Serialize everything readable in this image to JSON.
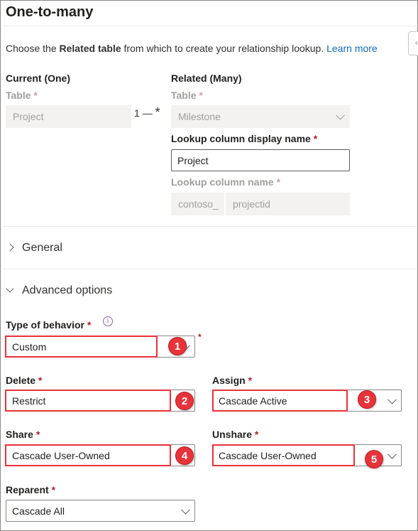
{
  "panel": {
    "title": "One-to-many",
    "intro_prefix": "Choose the ",
    "intro_bold": "Related table",
    "intro_suffix": " from which to create your relationship lookup. ",
    "learn_more": "Learn more"
  },
  "current": {
    "heading": "Current (One)",
    "table_label": "Table",
    "table_value": "Project"
  },
  "connector": {
    "one": "1",
    "dash": "—",
    "many": "*"
  },
  "related": {
    "heading": "Related (Many)",
    "table_label": "Table",
    "table_value": "Milestone",
    "lookup_display_label": "Lookup column display name",
    "lookup_display_value": "Project",
    "lookup_name_label": "Lookup column name",
    "lookup_prefix": "contoso_",
    "lookup_name_value": "projectid"
  },
  "required_marker": "*",
  "sections": {
    "general": "General",
    "advanced": "Advanced options"
  },
  "behavior": {
    "type_label": "Type of behavior",
    "type_value": "Custom",
    "info_icon": "i",
    "delete_label": "Delete",
    "delete_value": "Restrict",
    "assign_label": "Assign",
    "assign_value": "Cascade Active",
    "share_label": "Share",
    "share_value": "Cascade User-Owned",
    "unshare_label": "Unshare",
    "unshare_value": "Cascade User-Owned",
    "reparent_label": "Reparent",
    "reparent_value": "Cascade All"
  },
  "callouts": [
    "1",
    "2",
    "3",
    "4",
    "5"
  ],
  "colors": {
    "callout_red": "#e8333a",
    "link_blue": "#0f6cbd",
    "required_red": "#a4262c",
    "info_purple": "#8764b8"
  },
  "icons": {
    "expand": "chevron-right-icon",
    "collapse": "chevron-down-icon",
    "dropdown": "chevron-down-icon",
    "info": "info-icon"
  }
}
